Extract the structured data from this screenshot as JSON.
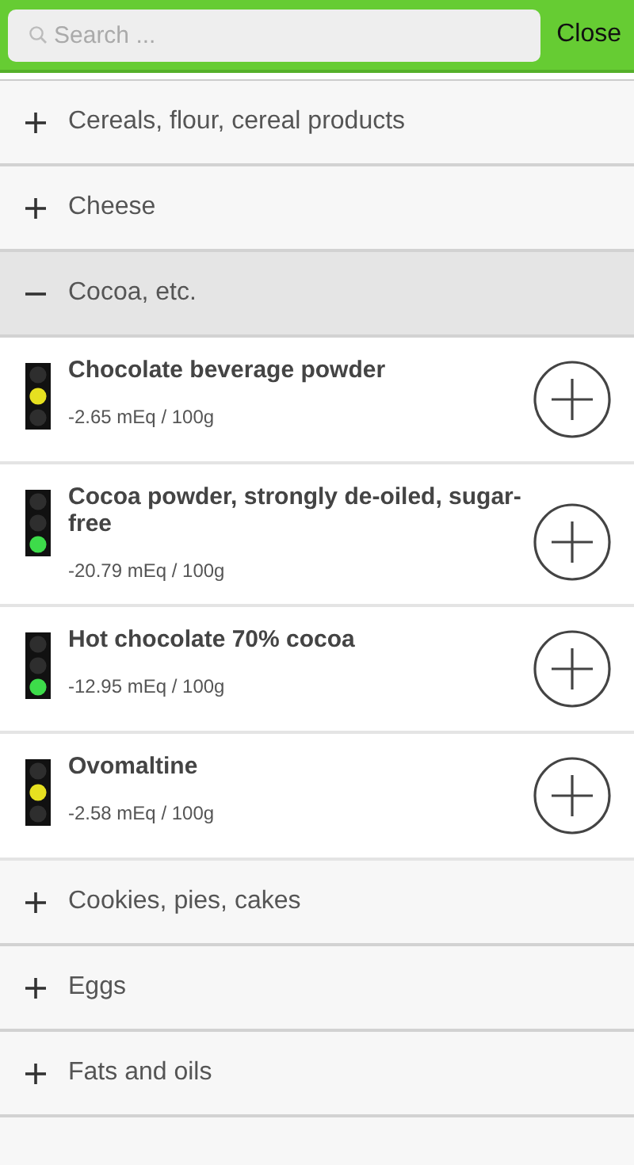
{
  "search": {
    "placeholder": "Search ..."
  },
  "close_button": "Close",
  "categories": [
    {
      "label": "Cereals, flour, cereal products",
      "expanded": false
    },
    {
      "label": "Cheese",
      "expanded": false
    },
    {
      "label": "Cocoa, etc.",
      "expanded": true,
      "items": [
        {
          "name": "Chocolate beverage powder",
          "value": "-2.65 mEq / 100g",
          "kind": "yellow"
        },
        {
          "name": "Cocoa powder, strongly de-oiled, sugar-free",
          "value": "-20.79 mEq / 100g",
          "kind": "green"
        },
        {
          "name": "Hot chocolate 70% cocoa",
          "value": "-12.95 mEq / 100g",
          "kind": "green"
        },
        {
          "name": "Ovomaltine",
          "value": "-2.58 mEq / 100g",
          "kind": "yellow"
        }
      ]
    },
    {
      "label": "Cookies, pies, cakes",
      "expanded": false
    },
    {
      "label": "Eggs",
      "expanded": false
    },
    {
      "label": "Fats and oils",
      "expanded": false
    }
  ]
}
